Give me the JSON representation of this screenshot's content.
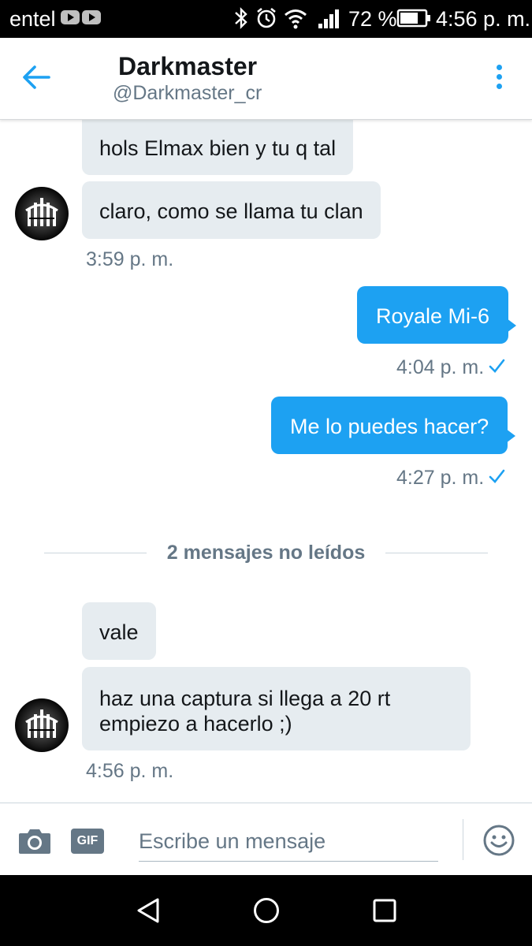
{
  "status_bar": {
    "carrier": "entel",
    "battery": "72 %",
    "time": "4:56 p. m."
  },
  "header": {
    "name": "Darkmaster",
    "handle": "@Darkmaster_cr"
  },
  "messages": [
    {
      "text": "hols Elmax bien y tu q tal",
      "direction": "incoming"
    },
    {
      "text": "claro, como se llama tu clan",
      "direction": "incoming",
      "time": "3:59 p. m."
    },
    {
      "text": "Royale Mi-6",
      "direction": "outgoing",
      "time": "4:04 p. m."
    },
    {
      "text": "Me lo puedes hacer?",
      "direction": "outgoing",
      "time": "4:27 p. m."
    },
    {
      "text": "vale",
      "direction": "incoming"
    },
    {
      "text_lines": [
        "haz una captura si llega a 20 rt",
        "empiezo a hacerlo ;)"
      ],
      "direction": "incoming",
      "time": "4:56 p. m."
    }
  ],
  "unread_divider": "2 mensajes no leídos",
  "composer": {
    "placeholder": "Escribe un mensaje",
    "gif_label": "GIF"
  },
  "colors": {
    "accent": "#1da1f2",
    "incoming_bubble": "#e6ecf0",
    "secondary_text": "#657786"
  },
  "icons": [
    "back-arrow-icon",
    "more-vertical-icon",
    "camera-icon",
    "gif-icon",
    "emoji-icon",
    "read-check-icon",
    "nav-back-icon",
    "nav-home-icon",
    "nav-recents-icon"
  ]
}
